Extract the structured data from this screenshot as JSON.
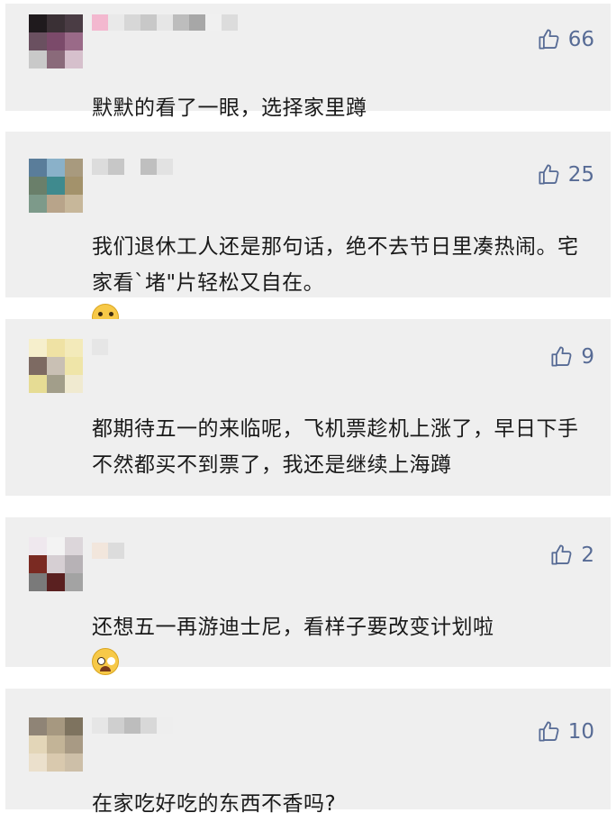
{
  "comments": [
    {
      "likes": "66",
      "text": "默默的看了一眼，选择家里蹲",
      "emoji": "",
      "avatar_colors": [
        "#1f1a1d",
        "#3a3035",
        "#4a3c44",
        "#6a5060",
        "#7b4a6a",
        "#9a6a88",
        "#c9c9c9",
        "#8a6a7a",
        "#d6c0cc"
      ],
      "nick_colors": [
        "#f3b8cf",
        "#e9e9e9",
        "#d7d7d7",
        "#c8c8c8",
        "#e6e6e6",
        "#bdbdbd",
        "#a7a7a7",
        "#f0f0f0",
        "#dcdcdc"
      ]
    },
    {
      "likes": "25",
      "text": "我们退休工人还是那句话，绝不去节日里凑热闹。宅家看`堵\"片轻松又自在。",
      "emoji": "tongue",
      "avatar_colors": [
        "#5a7d9a",
        "#8ab1c9",
        "#a89a7e",
        "#6a7f6a",
        "#3f8a8e",
        "#a3926b",
        "#7d9a8a",
        "#b8a48a",
        "#c7b79a"
      ],
      "nick_colors": [
        "#dcdcdc",
        "#c7c7c7",
        "#efefef",
        "#bfbfbf",
        "#e2e2e2"
      ]
    },
    {
      "likes": "9",
      "text": "都期待五一的来临呢，飞机票趁机上涨了，早日下手不然都买不到票了，我还是继续上海蹲",
      "emoji": "",
      "avatar_colors": [
        "#f6efcc",
        "#efe2a4",
        "#f3eaba",
        "#7d6a62",
        "#c9c0b4",
        "#efe5a8",
        "#e6dc94",
        "#a29e8a",
        "#f0ead0"
      ],
      "nick_colors": [
        "#e6e6e6"
      ]
    },
    {
      "likes": "2",
      "text": "还想五一再游迪士尼，看样子要改变计划啦",
      "emoji": "cry",
      "avatar_colors": [
        "#efe8ee",
        "#f3f3f3",
        "#dcd6da",
        "#7a2a22",
        "#d6cfd3",
        "#b7b2b6",
        "#7a7a7a",
        "#5a2020",
        "#a3a3a3"
      ],
      "nick_colors": [
        "#f2e6dc",
        "#dcdcdc"
      ]
    },
    {
      "likes": "10",
      "text": "在家吃好吃的东西不香吗?",
      "emoji": "",
      "avatar_colors": [
        "#8f8476",
        "#a69880",
        "#7e735f",
        "#e3d6b8",
        "#c3b497",
        "#a89a84",
        "#ebe0cc",
        "#d9c9ae",
        "#cdbfa8"
      ],
      "nick_colors": [
        "#e6e6e6",
        "#cfcfcf",
        "#bdbdbd",
        "#d8d8d8",
        "#eeeeee"
      ]
    }
  ],
  "icons": {
    "like": "thumbs-up-icon"
  },
  "colors": {
    "like": "#576b95",
    "card": "#efefef",
    "text": "#1a1a1a"
  }
}
